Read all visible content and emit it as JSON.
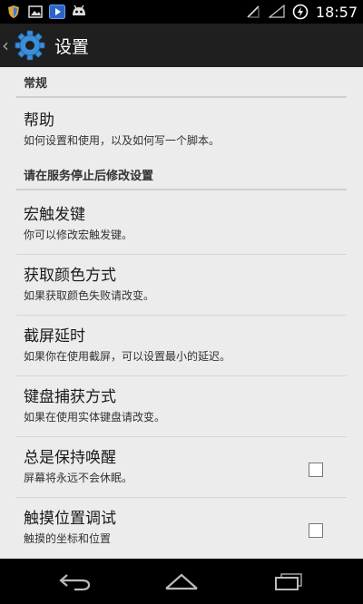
{
  "status_bar": {
    "time": "18:57",
    "icons": [
      "shield-icon",
      "image-icon",
      "play-icon",
      "android-icon",
      "no-signal-icon",
      "wifi-icon",
      "battery-charging-icon"
    ]
  },
  "action_bar": {
    "title": "设置"
  },
  "sections": [
    {
      "header": "常规",
      "items": [
        {
          "title": "帮助",
          "summary": "如何设置和使用，以及如何写一个脚本。"
        }
      ]
    },
    {
      "header": "请在服务停止后修改设置",
      "items": [
        {
          "title": "宏触发键",
          "summary": "你可以修改宏触发键。"
        },
        {
          "title": "获取颜色方式",
          "summary": "如果获取颜色失败请改变。"
        },
        {
          "title": "截屏延时",
          "summary": "如果你在使用截屏，可以设置最小的延迟。"
        },
        {
          "title": "键盘捕获方式",
          "summary": "如果在使用实体键盘请改变。"
        },
        {
          "title": "总是保持唤醒",
          "summary": "屏幕将永远不会休眠。",
          "checked": false
        },
        {
          "title": "触摸位置调试",
          "summary": "触摸的坐标和位置",
          "checked": false
        }
      ]
    }
  ],
  "nav_bar": {
    "icons": [
      "back-icon",
      "home-icon",
      "recents-icon"
    ]
  }
}
